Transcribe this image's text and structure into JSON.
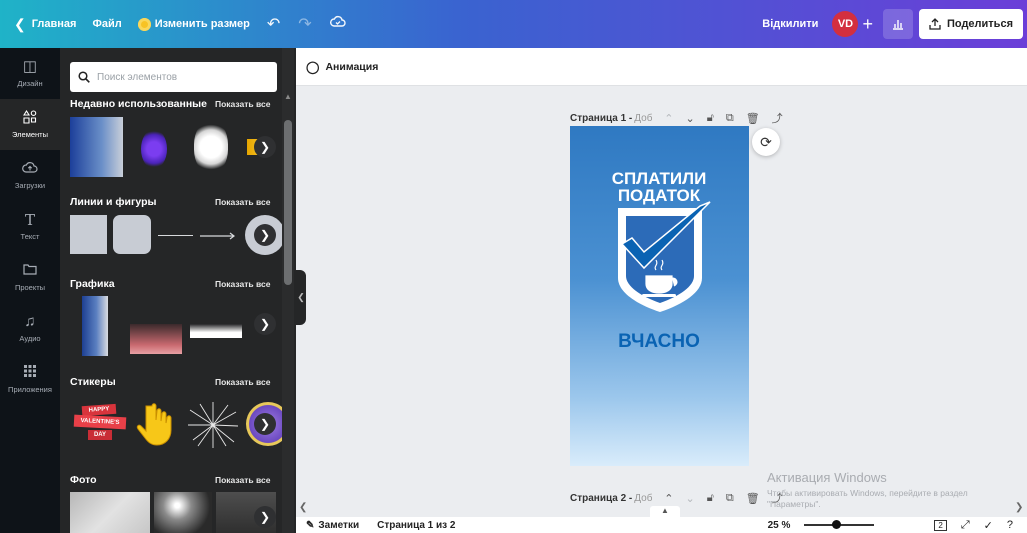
{
  "topbar": {
    "home": "Главная",
    "file": "Файл",
    "resize": "Изменить размер",
    "undo_icon": "undo-icon",
    "redo_icon": "redo-icon",
    "saved_icon": "cloud-check-icon",
    "unlock": "Відкилити",
    "avatar": "VD",
    "plus": "+",
    "share": "Поделиться"
  },
  "rail": [
    {
      "label": "Дизайн",
      "icon": "layout-icon"
    },
    {
      "label": "Элементы",
      "icon": "shapes-icon"
    },
    {
      "label": "Загрузки",
      "icon": "cloud-upload-icon"
    },
    {
      "label": "Текст",
      "icon": "text-icon"
    },
    {
      "label": "Проекты",
      "icon": "folder-icon"
    },
    {
      "label": "Аудио",
      "icon": "music-icon"
    },
    {
      "label": "Приложения",
      "icon": "apps-icon"
    }
  ],
  "panel": {
    "search_placeholder": "Поиск элементов",
    "show_all": "Показать все",
    "sections": [
      {
        "title": "Недавно использованные"
      },
      {
        "title": "Линии и фигуры"
      },
      {
        "title": "Графика"
      },
      {
        "title": "Стикеры"
      },
      {
        "title": "Фото"
      }
    ],
    "sticker_text": [
      "HAPPY",
      "VALENTINE'S",
      "DAY"
    ]
  },
  "editor": {
    "animation": "Анимация",
    "page1_label": "Страница 1 -",
    "page1_title": "Добавить заголовок",
    "page2_label": "Страница 2 -",
    "page2_title": "Добавить заголовок",
    "design_text": {
      "line1": "СПЛАТИЛИ",
      "line2": "ПОДАТОК",
      "bottom": "ВЧАСНО"
    },
    "accent_color": "#0a63b3"
  },
  "watermark": {
    "title": "Активация Windows",
    "text": "Чтобы активировать Windows, перейдите в раздел \"Параметры\"."
  },
  "footer": {
    "notes": "Заметки",
    "pages": "Страница 1 из 2",
    "zoom": "25 %",
    "page_count": "2"
  }
}
